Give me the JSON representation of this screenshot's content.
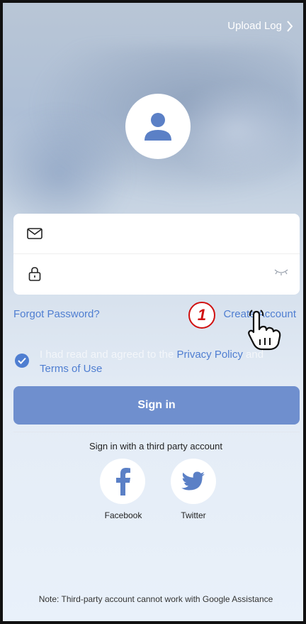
{
  "header": {
    "upload_log": "Upload Log"
  },
  "form": {
    "email_placeholder": "",
    "password_placeholder": ""
  },
  "links": {
    "forgot_password": "Forgot Password?",
    "create_account": "Create Account"
  },
  "annotation": {
    "step": "1"
  },
  "agreement": {
    "prefix": "I had read and agreed to the ",
    "privacy": "Privacy Policy",
    "and": " and",
    "terms": "Terms of Use",
    "checked": true
  },
  "signin_label": "Sign in",
  "third_party": {
    "heading": "Sign in with a third party account",
    "facebook": "Facebook",
    "twitter": "Twitter"
  },
  "note": "Note: Third-party account cannot work with Google Assistance",
  "colors": {
    "accent": "#4f7ed1",
    "button": "#6f8fce",
    "badge": "#d01010"
  }
}
